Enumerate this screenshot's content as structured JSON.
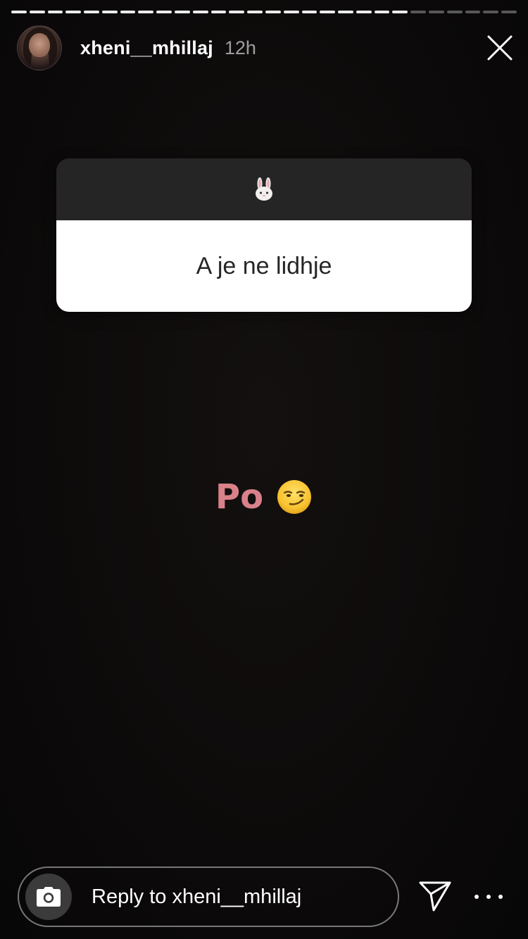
{
  "story": {
    "segments_total": 28,
    "segments_viewed": 22,
    "user": {
      "username": "xheni__mhillaj",
      "time_ago": "12h"
    }
  },
  "question_sticker": {
    "emoji_icon": "rabbit-face-emoji",
    "question": "A je ne lidhje"
  },
  "answer": {
    "text": "Po",
    "emoji_icon": "smirking-face-emoji",
    "text_color": "#d98189"
  },
  "reply": {
    "placeholder": "Reply to xheni__mhillaj"
  },
  "icons": {
    "close": "close-icon",
    "camera": "camera-icon",
    "send": "send-icon",
    "more": "more-options-icon"
  }
}
